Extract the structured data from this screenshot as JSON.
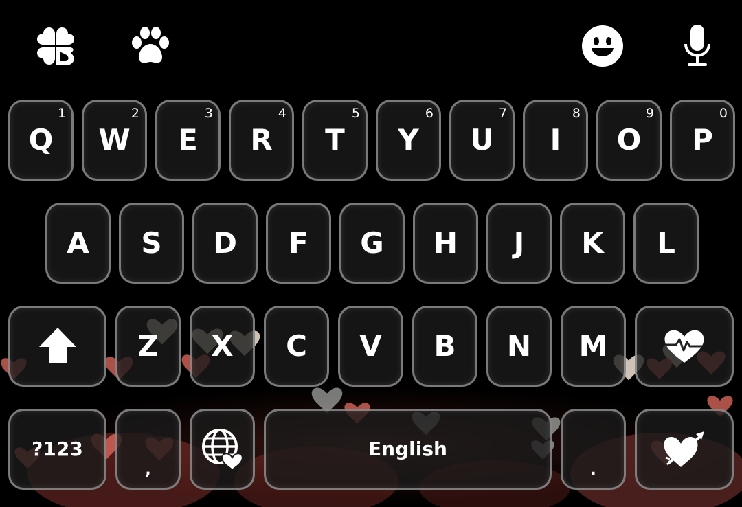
{
  "toolbar": {
    "left_icons": [
      "clover-icon",
      "paw-icon"
    ],
    "right_icons": [
      "emoji-icon",
      "microphone-icon"
    ]
  },
  "rows": {
    "row1": [
      {
        "key": "Q",
        "hint": "1"
      },
      {
        "key": "W",
        "hint": "2"
      },
      {
        "key": "E",
        "hint": "3"
      },
      {
        "key": "R",
        "hint": "4"
      },
      {
        "key": "T",
        "hint": "5"
      },
      {
        "key": "Y",
        "hint": "6"
      },
      {
        "key": "U",
        "hint": "7"
      },
      {
        "key": "I",
        "hint": "8"
      },
      {
        "key": "O",
        "hint": "9"
      },
      {
        "key": "P",
        "hint": "0"
      }
    ],
    "row2": [
      "A",
      "S",
      "D",
      "F",
      "G",
      "H",
      "J",
      "K",
      "L"
    ],
    "row3": [
      "Z",
      "X",
      "C",
      "V",
      "B",
      "N",
      "M"
    ]
  },
  "bottom": {
    "symbols_label": "?123",
    "comma_label": ",",
    "space_label": "English",
    "period_label": "."
  },
  "colors": {
    "key_fill": "#1a1a1a",
    "key_border": "#cdcdcd",
    "text": "#ffffff",
    "background": "#000000",
    "bokeh_red": "#e05a52",
    "bokeh_cream": "#f3e6d6"
  }
}
